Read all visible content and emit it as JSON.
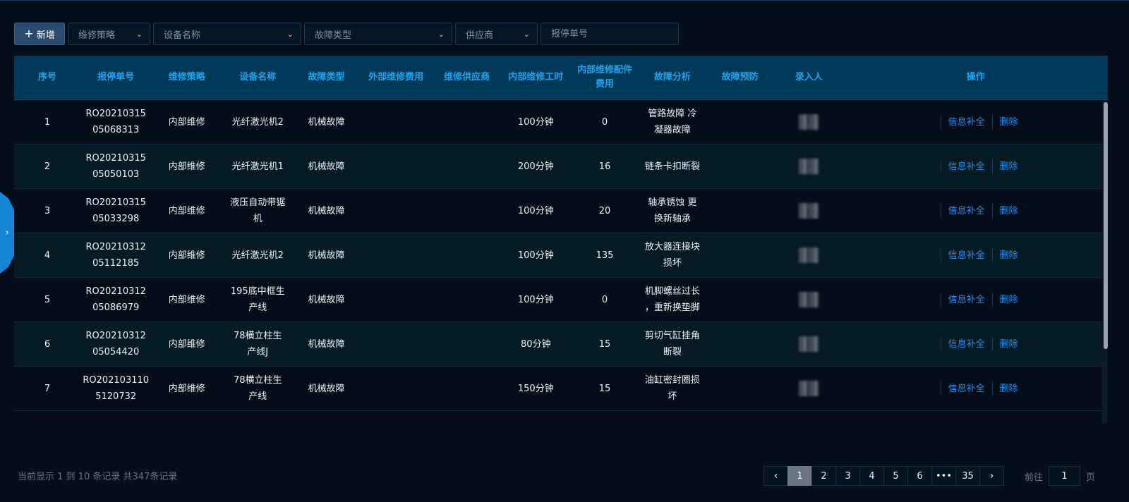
{
  "toolbar": {
    "add_label": "新增",
    "filters": [
      {
        "placeholder": "维修策略"
      },
      {
        "placeholder": "设备名称"
      },
      {
        "placeholder": "故障类型"
      },
      {
        "placeholder": "供应商"
      }
    ],
    "search_placeholder": "报停单号"
  },
  "table": {
    "headers": [
      "序号",
      "报停单号",
      "维修策略",
      "设备名称",
      "故障类型",
      "外部维修费用",
      "维修供应商",
      "内部维修工时",
      "内部维修配件\n费用",
      "故障分析",
      "故障预防",
      "录入人",
      "操作"
    ],
    "rows": [
      {
        "no": "1",
        "order": "RO20210315\n05068313",
        "strategy": "内部维修",
        "device": "光纤激光机2",
        "fault": "机械故障",
        "ext_cost": "",
        "supplier": "",
        "hours": "100分钟",
        "parts": "0",
        "analysis": "管路故障 冷\n凝器故障",
        "prevention": ""
      },
      {
        "no": "2",
        "order": "RO20210315\n05050103",
        "strategy": "内部维修",
        "device": "光纤激光机1",
        "fault": "机械故障",
        "ext_cost": "",
        "supplier": "",
        "hours": "200分钟",
        "parts": "16",
        "analysis": "链条卡扣断裂",
        "prevention": ""
      },
      {
        "no": "3",
        "order": "RO20210315\n05033298",
        "strategy": "内部维修",
        "device": "液压自动带锯\n机",
        "fault": "机械故障",
        "ext_cost": "",
        "supplier": "",
        "hours": "100分钟",
        "parts": "20",
        "analysis": "轴承锈蚀 更\n换新轴承",
        "prevention": ""
      },
      {
        "no": "4",
        "order": "RO20210312\n05112185",
        "strategy": "内部维修",
        "device": "光纤激光机2",
        "fault": "机械故障",
        "ext_cost": "",
        "supplier": "",
        "hours": "100分钟",
        "parts": "135",
        "analysis": "放大器连接块\n损坏",
        "prevention": ""
      },
      {
        "no": "5",
        "order": "RO20210312\n05086979",
        "strategy": "内部维修",
        "device": "195底中框生\n产线",
        "fault": "机械故障",
        "ext_cost": "",
        "supplier": "",
        "hours": "100分钟",
        "parts": "0",
        "analysis": "机脚螺丝过长\n，重新换垫脚",
        "prevention": ""
      },
      {
        "no": "6",
        "order": "RO20210312\n05054420",
        "strategy": "内部维修",
        "device": "78横立柱生\n产线J",
        "fault": "机械故障",
        "ext_cost": "",
        "supplier": "",
        "hours": "80分钟",
        "parts": "15",
        "analysis": "剪切气缸挂角\n断裂",
        "prevention": ""
      },
      {
        "no": "7",
        "order": "RO202103110\n5120732",
        "strategy": "内部维修",
        "device": "78横立柱生\n产线",
        "fault": "机械故障",
        "ext_cost": "",
        "supplier": "",
        "hours": "150分钟",
        "parts": "15",
        "analysis": "油缸密封圈损\n坏",
        "prevention": ""
      }
    ],
    "actions": {
      "edit": "信息补全",
      "delete": "删除"
    }
  },
  "footer": {
    "info": "当前显示 1 到 10 条记录 共347条记录",
    "pages": [
      "1",
      "2",
      "3",
      "4",
      "5",
      "6",
      "•••",
      "35"
    ],
    "prev": "‹",
    "next": "›",
    "goto_prefix": "前往",
    "goto_value": "1",
    "goto_suffix": "页"
  },
  "colors": {
    "accent": "#1fa3f0",
    "link": "#1f8ff0",
    "header_bg": "#003a58",
    "bg": "#040d18"
  }
}
